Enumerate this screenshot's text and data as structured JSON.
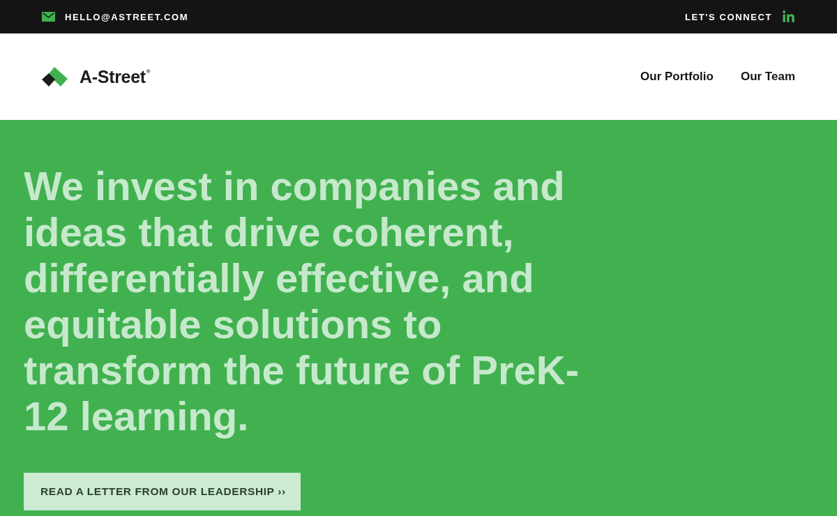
{
  "top_bar": {
    "email": "HELLO@ASTREET.COM",
    "connect_label": "LET'S CONNECT"
  },
  "header": {
    "logo_text": "A-Street$^{®}$",
    "nav": [
      {
        "label": "Our Portfolio"
      },
      {
        "label": "Our Team"
      }
    ]
  },
  "hero": {
    "headline": "We invest in companies and ideas that drive coherent, differentially effective, and equitable solutions to transform the future of PreK-12 learning.",
    "button": "READ A LETTER FROM OUR LEADERSHIP ››"
  }
}
